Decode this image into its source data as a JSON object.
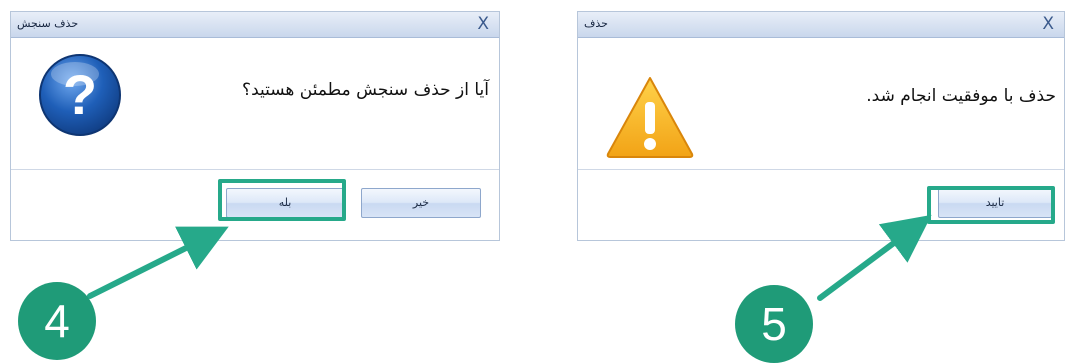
{
  "dialog_confirm": {
    "title": "حذف سنجش",
    "close_label": "X",
    "message": "آیا از حذف سنجش مطمئن هستید؟",
    "icon": "question-icon",
    "yes_label": "بله",
    "no_label": "خیر"
  },
  "dialog_success": {
    "title": "حذف",
    "close_label": "X",
    "message": "حذف با موفقیت انجام شد.",
    "icon": "warning-icon",
    "ok_label": "تایید"
  },
  "callouts": {
    "step_4": "4",
    "step_5": "5"
  },
  "colors": {
    "callout": "#1f9b78",
    "highlight": "#26a98a",
    "question_icon": "#1f5fb8",
    "warning_icon": "#f2a316"
  }
}
